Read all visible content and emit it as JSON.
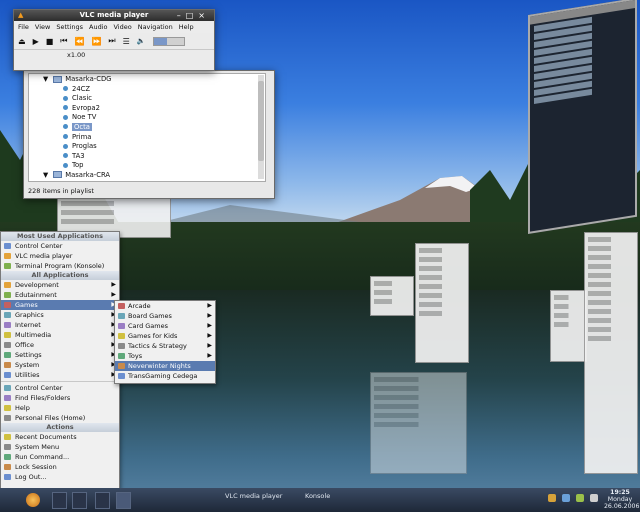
{
  "vlc": {
    "title": "VLC media player",
    "menu": [
      "File",
      "View",
      "Settings",
      "Audio",
      "Video",
      "Navigation",
      "Help"
    ],
    "controls": {
      "eject": "⏏",
      "play": "▶",
      "stop": "■",
      "prev": "⏮",
      "rew": "⏪",
      "fwd": "⏩",
      "next": "⏭",
      "playlist": "☰",
      "volume": "🔈"
    },
    "speed": "x1.00",
    "volume_level": 0.45
  },
  "playlist": {
    "items": [
      {
        "label": "Masarka-CDG",
        "kind": "folder"
      },
      {
        "label": "24CZ",
        "kind": "stream"
      },
      {
        "label": "Clasic",
        "kind": "stream"
      },
      {
        "label": "Evropa2",
        "kind": "stream"
      },
      {
        "label": "Noe TV",
        "kind": "stream"
      },
      {
        "label": "Octa",
        "kind": "stream",
        "selected": true
      },
      {
        "label": "Prima",
        "kind": "stream"
      },
      {
        "label": "Proglas",
        "kind": "stream"
      },
      {
        "label": "TA3",
        "kind": "stream"
      },
      {
        "label": "Top",
        "kind": "stream"
      },
      {
        "label": "Masarka-CRA",
        "kind": "folder"
      }
    ],
    "footer": "228 items in playlist"
  },
  "kmenu": {
    "most_used_header": "Most Used Applications",
    "most_used": [
      "Control Center",
      "VLC media player",
      "Terminal Program (Konsole)"
    ],
    "all_apps_header": "All Applications",
    "categories": [
      "Development",
      "Edutainment",
      "Games",
      "Graphics",
      "Internet",
      "Multimedia",
      "Office",
      "Settings",
      "System",
      "Utilities"
    ],
    "selected_category": "Games",
    "extras": [
      "Control Center",
      "Find Files/Folders",
      "Help",
      "Personal Files (Home)"
    ],
    "actions_header": "Actions",
    "actions": [
      "Recent Documents",
      "System Menu",
      "Run Command...",
      "Lock Session",
      "Log Out..."
    ]
  },
  "games_menu": {
    "items": [
      {
        "label": "Arcade",
        "submenu": true
      },
      {
        "label": "Board Games",
        "submenu": true
      },
      {
        "label": "Card Games",
        "submenu": true
      },
      {
        "label": "Games for Kids",
        "submenu": true
      },
      {
        "label": "Tactics & Strategy",
        "submenu": true
      },
      {
        "label": "Toys",
        "submenu": true
      },
      {
        "label": "Neverwinter Nights",
        "submenu": false,
        "selected": true
      },
      {
        "label": "TransGaming Cedega",
        "submenu": false
      }
    ]
  },
  "taskbar": {
    "tasks": [
      "VLC media player",
      "Konsole"
    ],
    "clock_time": "19:25",
    "clock_day": "Monday",
    "clock_date": "26.06.2006"
  },
  "colors": {
    "accent": "#5a7bb0",
    "vlc_orange": "#f29a1e",
    "taskbar": "#2a3448"
  }
}
